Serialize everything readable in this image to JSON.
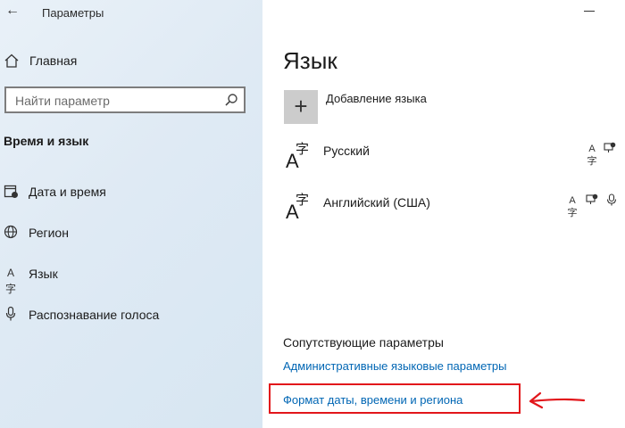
{
  "window": {
    "title": "Параметры"
  },
  "sidebar": {
    "home_label": "Главная",
    "search_placeholder": "Найти параметр",
    "section_title": "Время и язык",
    "items": [
      {
        "label": "Дата и время",
        "icon": "calendar-clock-icon"
      },
      {
        "label": "Регион",
        "icon": "globe-icon"
      },
      {
        "label": "Язык",
        "icon": "language-icon"
      },
      {
        "label": "Распознавание голоса",
        "icon": "microphone-icon"
      }
    ]
  },
  "main": {
    "title": "Язык",
    "add_language_label": "Добавление языка",
    "languages": [
      {
        "name": "Русский",
        "features": [
          "display-language-icon",
          "speech-feature-icon"
        ]
      },
      {
        "name": "Английский (США)",
        "features": [
          "display-language-icon",
          "speech-feature-icon",
          "microphone-icon"
        ]
      }
    ],
    "related": {
      "title": "Сопутствующие параметры",
      "links": [
        "Административные языковые параметры",
        "Формат даты, времени и региона"
      ]
    }
  },
  "colors": {
    "link": "#0066b4",
    "highlight": "#e2161b",
    "sidebar_bg": "#dfeaf4"
  }
}
